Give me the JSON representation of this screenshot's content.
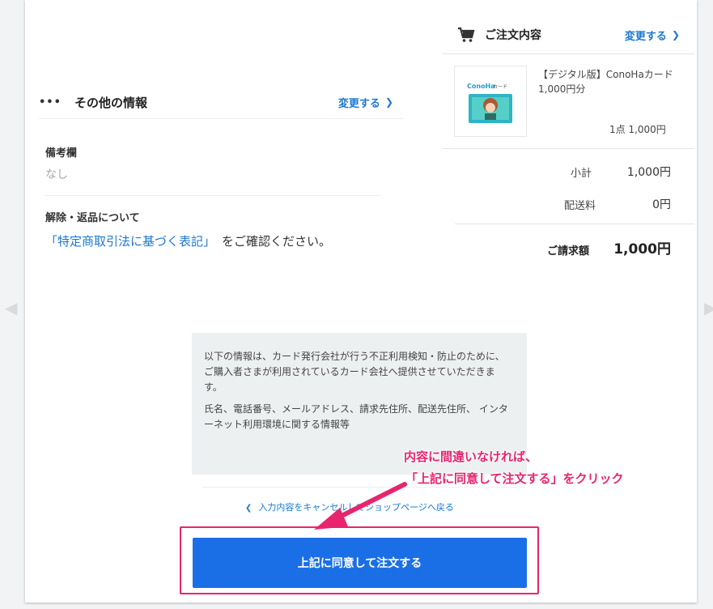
{
  "other_info": {
    "title": "その他の情報",
    "edit_label": "変更する",
    "remarks_label": "備考欄",
    "remarks_value": "なし",
    "cancellation_label": "解除・返品について",
    "law_link": "「特定商取引法に基づく表記」",
    "law_suffix": "をご確認ください。"
  },
  "order": {
    "title": "ご注文内容",
    "edit_label": "変更する",
    "product_name": "【デジタル版】ConoHaカード 1,000円分",
    "product_qty": "1点  1,000円",
    "thumb_brand": "ConoHa",
    "thumb_suffix": "カード",
    "subtotal_label": "小計",
    "subtotal_value": "1,000円",
    "shipping_label": "配送料",
    "shipping_value": "0円",
    "total_label": "ご請求額",
    "total_value": "1,000円"
  },
  "info_box": {
    "para1": "以下の情報は、カード発行会社が行う不正利用検知・防止のために、ご購入者さまが利用されているカード会社へ提供させていただきます。",
    "para2": "氏名、電話番号、メールアドレス、請求先住所、配送先住所、 インターネット利用環境に関する情報等"
  },
  "annotation": {
    "line1": "内容に間違いなければ、",
    "line2": "「上記に同意して注文する」をクリック"
  },
  "cancel_link": "入力内容をキャンセルしてショップページへ戻る",
  "submit_label": "上記に同意して注文する",
  "colors": {
    "accent": "#1a6fe6",
    "link": "#1b78d0",
    "highlight": "#e8246e"
  },
  "icons": [
    "more-dots-icon",
    "chevron-right-icon",
    "cart-icon",
    "chevron-left-icon"
  ]
}
